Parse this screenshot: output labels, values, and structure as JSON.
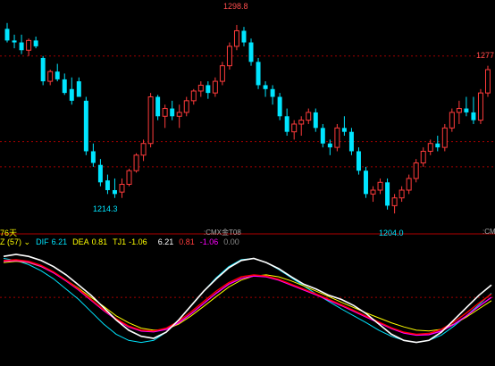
{
  "colors": {
    "background": "#000000",
    "up": "#ff3b3b",
    "down": "#00e5ff",
    "grid": "#a00000",
    "separator": "#b00000",
    "dif": "#ffffff",
    "dea": "#ffff00",
    "tj1": "#00e5ff",
    "red_line": "#ff0000",
    "magenta_line": "#ff00ff"
  },
  "labels": {
    "days": "76天",
    "instrument": ":CMX金T08",
    "right_edge": ":CM"
  },
  "indicator_bar": {
    "name": "Z (57)",
    "dropdown_icon": "chevron-down-icon",
    "dif_label": "DIF",
    "dif_value": "6.21",
    "dea_label": "DEA",
    "dea_value": "0.81",
    "tj1_label": "TJ1",
    "tj1_value": "-1.06",
    "v1": "6.21",
    "v2": "0.81",
    "v3": "-1.06",
    "v4": "0.00"
  },
  "chart_data": [
    {
      "type": "candlestick",
      "title": "",
      "annotations": [
        {
          "text": "1298.8",
          "role": "high",
          "index": 32
        },
        {
          "text": "1214.3",
          "role": "low",
          "index": 14
        },
        {
          "text": "1204.0",
          "role": "low",
          "index": 53
        },
        {
          "text": "1277",
          "role": "last",
          "index": 67
        }
      ],
      "ylim": [
        1197,
        1310
      ],
      "gridlines": [
        1283,
        1239,
        1226
      ],
      "candles": [
        {
          "o": 1297,
          "h": 1300,
          "l": 1290,
          "c": 1291
        },
        {
          "o": 1291,
          "h": 1294,
          "l": 1287,
          "c": 1290
        },
        {
          "o": 1290,
          "h": 1294,
          "l": 1284,
          "c": 1286
        },
        {
          "o": 1286,
          "h": 1292,
          "l": 1283,
          "c": 1291
        },
        {
          "o": 1291,
          "h": 1293,
          "l": 1287,
          "c": 1288
        },
        {
          "o": 1282,
          "h": 1283,
          "l": 1268,
          "c": 1270
        },
        {
          "o": 1270,
          "h": 1276,
          "l": 1268,
          "c": 1275
        },
        {
          "o": 1275,
          "h": 1279,
          "l": 1270,
          "c": 1271
        },
        {
          "o": 1271,
          "h": 1274,
          "l": 1263,
          "c": 1264
        },
        {
          "o": 1266,
          "h": 1272,
          "l": 1258,
          "c": 1260
        },
        {
          "o": 1270,
          "h": 1272,
          "l": 1262,
          "c": 1262
        },
        {
          "o": 1260,
          "h": 1262,
          "l": 1232,
          "c": 1234
        },
        {
          "o": 1234,
          "h": 1238,
          "l": 1226,
          "c": 1228
        },
        {
          "o": 1227,
          "h": 1230,
          "l": 1216,
          "c": 1218
        },
        {
          "o": 1219,
          "h": 1222,
          "l": 1212,
          "c": 1214
        },
        {
          "o": 1214,
          "h": 1220,
          "l": 1210,
          "c": 1212
        },
        {
          "o": 1213,
          "h": 1220,
          "l": 1210,
          "c": 1217
        },
        {
          "o": 1217,
          "h": 1225,
          "l": 1216,
          "c": 1224
        },
        {
          "o": 1224,
          "h": 1233,
          "l": 1223,
          "c": 1232
        },
        {
          "o": 1232,
          "h": 1240,
          "l": 1229,
          "c": 1238
        },
        {
          "o": 1238,
          "h": 1264,
          "l": 1236,
          "c": 1262
        },
        {
          "o": 1262,
          "h": 1263,
          "l": 1250,
          "c": 1252
        },
        {
          "o": 1252,
          "h": 1258,
          "l": 1246,
          "c": 1256
        },
        {
          "o": 1256,
          "h": 1260,
          "l": 1250,
          "c": 1252
        },
        {
          "o": 1252,
          "h": 1258,
          "l": 1246,
          "c": 1254
        },
        {
          "o": 1254,
          "h": 1262,
          "l": 1252,
          "c": 1260
        },
        {
          "o": 1260,
          "h": 1266,
          "l": 1258,
          "c": 1265
        },
        {
          "o": 1265,
          "h": 1270,
          "l": 1262,
          "c": 1268
        },
        {
          "o": 1268,
          "h": 1270,
          "l": 1261,
          "c": 1264
        },
        {
          "o": 1264,
          "h": 1272,
          "l": 1262,
          "c": 1270
        },
        {
          "o": 1270,
          "h": 1280,
          "l": 1268,
          "c": 1278
        },
        {
          "o": 1278,
          "h": 1290,
          "l": 1276,
          "c": 1288
        },
        {
          "o": 1288,
          "h": 1299,
          "l": 1286,
          "c": 1296
        },
        {
          "o": 1296,
          "h": 1298,
          "l": 1288,
          "c": 1290
        },
        {
          "o": 1290,
          "h": 1292,
          "l": 1278,
          "c": 1280
        },
        {
          "o": 1280,
          "h": 1282,
          "l": 1266,
          "c": 1268
        },
        {
          "o": 1268,
          "h": 1270,
          "l": 1262,
          "c": 1266
        },
        {
          "o": 1266,
          "h": 1268,
          "l": 1258,
          "c": 1262
        },
        {
          "o": 1262,
          "h": 1264,
          "l": 1250,
          "c": 1252
        },
        {
          "o": 1252,
          "h": 1256,
          "l": 1242,
          "c": 1244
        },
        {
          "o": 1244,
          "h": 1250,
          "l": 1240,
          "c": 1248
        },
        {
          "o": 1248,
          "h": 1252,
          "l": 1242,
          "c": 1250
        },
        {
          "o": 1250,
          "h": 1256,
          "l": 1248,
          "c": 1254
        },
        {
          "o": 1254,
          "h": 1256,
          "l": 1244,
          "c": 1246
        },
        {
          "o": 1246,
          "h": 1248,
          "l": 1236,
          "c": 1238
        },
        {
          "o": 1238,
          "h": 1240,
          "l": 1232,
          "c": 1236
        },
        {
          "o": 1236,
          "h": 1248,
          "l": 1234,
          "c": 1246
        },
        {
          "o": 1246,
          "h": 1252,
          "l": 1242,
          "c": 1244
        },
        {
          "o": 1244,
          "h": 1246,
          "l": 1232,
          "c": 1234
        },
        {
          "o": 1234,
          "h": 1236,
          "l": 1222,
          "c": 1224
        },
        {
          "o": 1224,
          "h": 1226,
          "l": 1210,
          "c": 1212
        },
        {
          "o": 1212,
          "h": 1216,
          "l": 1208,
          "c": 1214
        },
        {
          "o": 1214,
          "h": 1220,
          "l": 1212,
          "c": 1218
        },
        {
          "o": 1218,
          "h": 1220,
          "l": 1204,
          "c": 1206
        },
        {
          "o": 1206,
          "h": 1212,
          "l": 1202,
          "c": 1210
        },
        {
          "o": 1210,
          "h": 1216,
          "l": 1208,
          "c": 1214
        },
        {
          "o": 1214,
          "h": 1222,
          "l": 1212,
          "c": 1220
        },
        {
          "o": 1220,
          "h": 1230,
          "l": 1218,
          "c": 1228
        },
        {
          "o": 1228,
          "h": 1236,
          "l": 1226,
          "c": 1234
        },
        {
          "o": 1234,
          "h": 1240,
          "l": 1232,
          "c": 1238
        },
        {
          "o": 1238,
          "h": 1242,
          "l": 1234,
          "c": 1236
        },
        {
          "o": 1236,
          "h": 1248,
          "l": 1234,
          "c": 1246
        },
        {
          "o": 1246,
          "h": 1256,
          "l": 1244,
          "c": 1254
        },
        {
          "o": 1254,
          "h": 1260,
          "l": 1248,
          "c": 1256
        },
        {
          "o": 1256,
          "h": 1262,
          "l": 1252,
          "c": 1254
        },
        {
          "o": 1254,
          "h": 1262,
          "l": 1248,
          "c": 1250
        },
        {
          "o": 1250,
          "h": 1266,
          "l": 1248,
          "c": 1264
        },
        {
          "o": 1264,
          "h": 1278,
          "l": 1262,
          "c": 1276
        }
      ]
    },
    {
      "type": "line",
      "ylim": [
        -1.5,
        1.2
      ],
      "zero_line": 0,
      "series": [
        {
          "key": "white",
          "values": [
            1.0,
            1.05,
            1.0,
            0.9,
            0.75,
            0.55,
            0.3,
            0.05,
            -0.25,
            -0.55,
            -0.8,
            -0.95,
            -1.0,
            -0.85,
            -0.55,
            -0.2,
            0.15,
            0.45,
            0.72,
            0.9,
            0.95,
            0.85,
            0.7,
            0.5,
            0.32,
            0.2,
            0.05,
            -0.05,
            -0.2,
            -0.4,
            -0.65,
            -0.9,
            -1.05,
            -1.1,
            -1.05,
            -0.85,
            -0.55,
            -0.25,
            0.05,
            0.3
          ]
        },
        {
          "key": "cyan",
          "values": [
            0.95,
            0.9,
            0.8,
            0.65,
            0.45,
            0.2,
            -0.05,
            -0.35,
            -0.65,
            -0.9,
            -1.05,
            -1.1,
            -1.05,
            -0.85,
            -0.55,
            -0.2,
            0.15,
            0.48,
            0.75,
            0.92,
            0.95,
            0.85,
            0.68,
            0.48,
            0.28,
            0.08,
            -0.1,
            -0.28,
            -0.45,
            -0.62,
            -0.8,
            -0.95,
            -1.05,
            -1.1,
            -1.05,
            -0.92,
            -0.7,
            -0.45,
            -0.18,
            0.1
          ]
        },
        {
          "key": "yellow",
          "values": [
            0.85,
            0.88,
            0.85,
            0.75,
            0.6,
            0.42,
            0.22,
            0.0,
            -0.22,
            -0.45,
            -0.62,
            -0.75,
            -0.8,
            -0.78,
            -0.65,
            -0.45,
            -0.22,
            0.02,
            0.25,
            0.42,
            0.52,
            0.55,
            0.5,
            0.4,
            0.28,
            0.15,
            0.02,
            -0.12,
            -0.25,
            -0.38,
            -0.5,
            -0.62,
            -0.72,
            -0.8,
            -0.82,
            -0.78,
            -0.65,
            -0.48,
            -0.28,
            -0.08
          ]
        },
        {
          "key": "red",
          "values": [
            0.9,
            0.92,
            0.88,
            0.78,
            0.62,
            0.42,
            0.2,
            -0.05,
            -0.3,
            -0.52,
            -0.7,
            -0.8,
            -0.82,
            -0.75,
            -0.58,
            -0.35,
            -0.1,
            0.15,
            0.36,
            0.5,
            0.55,
            0.52,
            0.44,
            0.32,
            0.2,
            0.08,
            -0.05,
            -0.18,
            -0.32,
            -0.46,
            -0.6,
            -0.74,
            -0.85,
            -0.9,
            -0.88,
            -0.78,
            -0.6,
            -0.38,
            -0.14,
            0.08
          ]
        },
        {
          "key": "magenta",
          "values": [
            0.88,
            0.9,
            0.86,
            0.76,
            0.6,
            0.4,
            0.18,
            -0.07,
            -0.32,
            -0.54,
            -0.72,
            -0.82,
            -0.84,
            -0.78,
            -0.62,
            -0.4,
            -0.15,
            0.1,
            0.32,
            0.46,
            0.52,
            0.5,
            0.42,
            0.3,
            0.18,
            0.06,
            -0.07,
            -0.2,
            -0.34,
            -0.48,
            -0.62,
            -0.76,
            -0.87,
            -0.92,
            -0.91,
            -0.82,
            -0.66,
            -0.45,
            -0.22,
            0.0
          ]
        }
      ]
    }
  ]
}
